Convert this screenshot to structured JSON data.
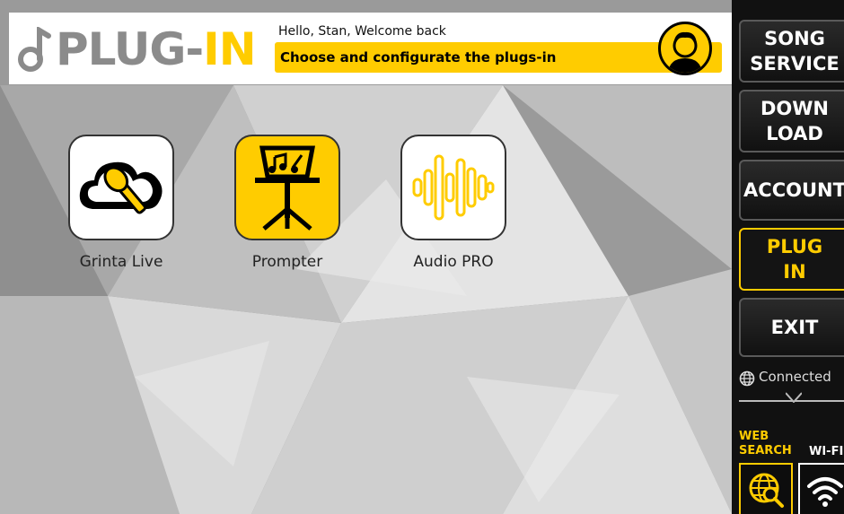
{
  "header": {
    "logo_text_part1": "PLUG-",
    "logo_text_part2": "IN",
    "greeting": "Hello, Stan, Welcome back",
    "subtitle": "Choose and configurate the plugs-in",
    "avatar_icon": "user-avatar-icon"
  },
  "plugins": [
    {
      "label": "Grinta Live",
      "icon": "cloud-microphone-icon"
    },
    {
      "label": "Prompter",
      "icon": "music-stand-icon"
    },
    {
      "label": "Audio PRO",
      "icon": "waveform-icon"
    }
  ],
  "sidebar": {
    "buttons": [
      {
        "line1": "SONG",
        "line2": "SERVICE"
      },
      {
        "line1": "DOWN",
        "line2": "LOAD"
      },
      {
        "line1": "ACCOUNT",
        "line2": ""
      },
      {
        "line1": "PLUG",
        "line2": "IN",
        "active": true
      },
      {
        "line1": "EXIT",
        "line2": ""
      }
    ],
    "status": "Connected",
    "web_search_line1": "WEB",
    "web_search_line2": "SEARCH",
    "wifi_label": "WI-FI"
  },
  "colors": {
    "accent": "#ffcc00",
    "panel": "#111111",
    "logo_gray": "#8b8b8b"
  }
}
